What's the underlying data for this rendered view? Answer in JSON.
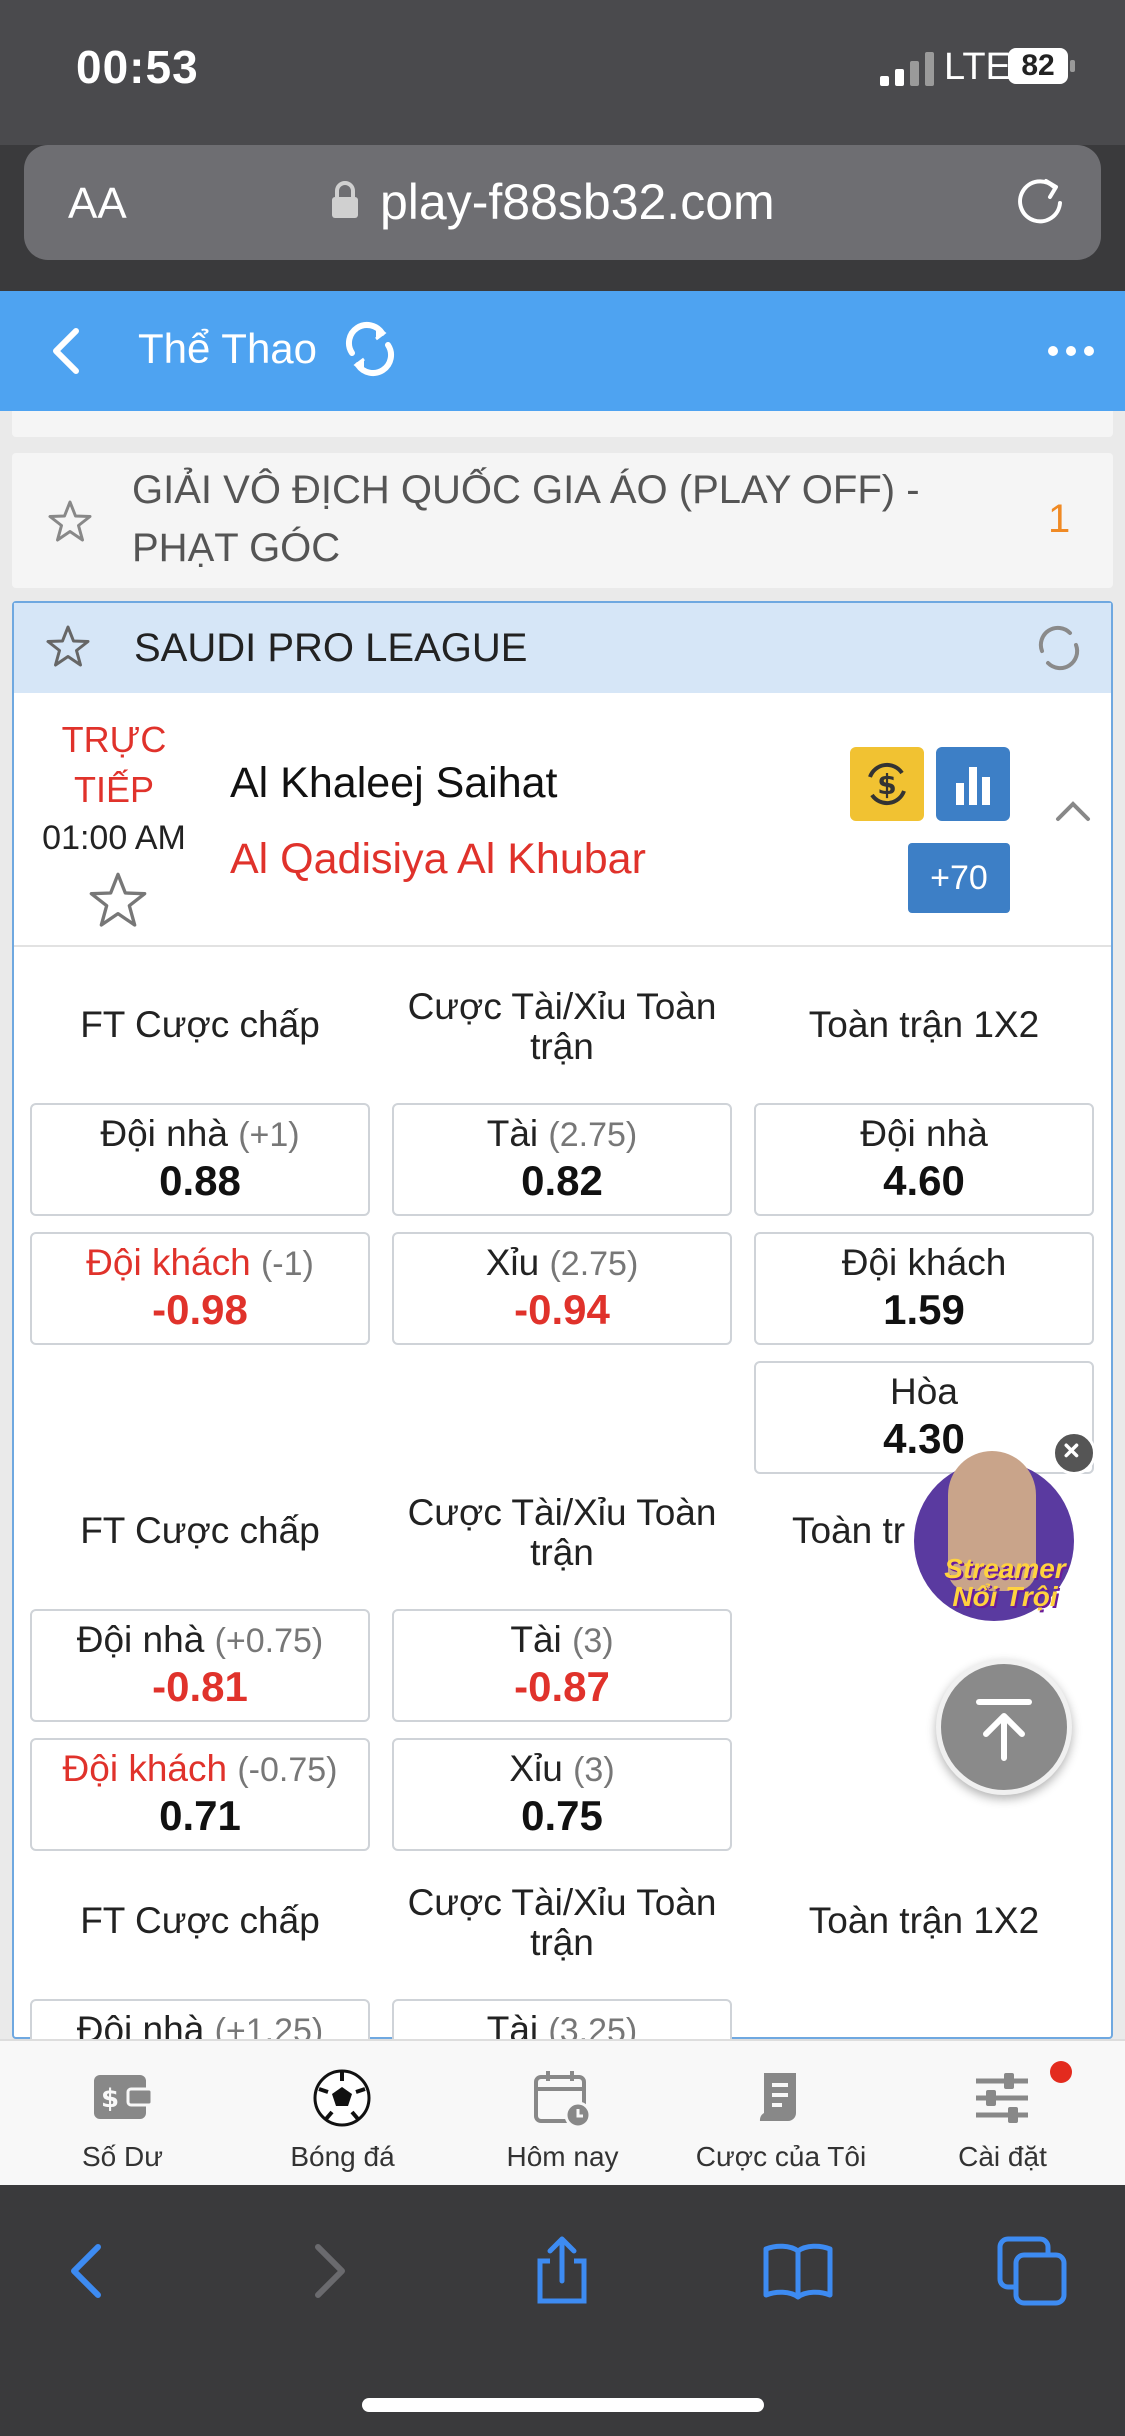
{
  "status": {
    "time": "00:53",
    "network": "LTE",
    "battery": "82"
  },
  "browser": {
    "text_size": "AA",
    "url": "play-f88sb32.com"
  },
  "header": {
    "title": "Thể Thao"
  },
  "leagues": [
    {
      "name": "GIẢI VÔ ĐỊCH QUỐC GIA ÁO (PLAY OFF) - PHẠT GÓC",
      "count": "1"
    },
    {
      "name": "SAUDI PRO LEAGUE"
    }
  ],
  "match": {
    "status_line1": "TRỰC",
    "status_line2": "TIẾP",
    "time": "01:00 AM",
    "home_team": "Al Khaleej Saihat",
    "away_team": "Al Qadisiya Al Khubar",
    "more_markets": "+70"
  },
  "markets": [
    {
      "headers": [
        "FT Cược chấp",
        "Cược Tài/Xỉu Toàn trận",
        "Toàn trận 1X2"
      ],
      "handicap": [
        {
          "label": "Đội nhà",
          "line": "(+1)",
          "odds": "0.88"
        },
        {
          "label": "Đội khách",
          "line": "(-1)",
          "odds": "-0.98"
        }
      ],
      "overunder": [
        {
          "label": "Tài",
          "line": "(2.75)",
          "odds": "0.82"
        },
        {
          "label": "Xỉu",
          "line": "(2.75)",
          "odds": "-0.94"
        }
      ],
      "x12": [
        {
          "label": "Đội nhà",
          "odds": "4.60"
        },
        {
          "label": "Đội khách",
          "odds": "1.59"
        },
        {
          "label": "Hòa",
          "odds": "4.30"
        }
      ]
    },
    {
      "headers": [
        "FT Cược chấp",
        "Cược Tài/Xỉu Toàn trận",
        "Toàn tr"
      ],
      "handicap": [
        {
          "label": "Đội nhà",
          "line": "(+0.75)",
          "odds": "-0.81"
        },
        {
          "label": "Đội khách",
          "line": "(-0.75)",
          "odds": "0.71"
        }
      ],
      "overunder": [
        {
          "label": "Tài",
          "line": "(3)",
          "odds": "-0.87"
        },
        {
          "label": "Xỉu",
          "line": "(3)",
          "odds": "0.75"
        }
      ]
    },
    {
      "headers": [
        "FT Cược chấp",
        "Cược Tài/Xỉu Toàn trận",
        "Toàn trận 1X2"
      ],
      "handicap": [
        {
          "label": "Đội nhà",
          "line": "(+1.25)"
        }
      ],
      "overunder": [
        {
          "label": "Tài",
          "line": "(3.25)"
        }
      ]
    }
  ],
  "promo": {
    "line1": "Streamer",
    "line2": "Nổi Trội"
  },
  "bottom_nav": [
    {
      "label": "Số Dư",
      "icon": "wallet-icon"
    },
    {
      "label": "Bóng đá",
      "icon": "soccer-ball-icon"
    },
    {
      "label": "Hôm nay",
      "icon": "calendar-icon"
    },
    {
      "label": "Cược của Tôi",
      "icon": "bet-slip-icon"
    },
    {
      "label": "Cài đặt",
      "icon": "settings-sliders-icon"
    }
  ],
  "colors": {
    "header_blue": "#4ea3f1",
    "odds_red": "#e0322b",
    "live_red": "#e0322b",
    "league_header_bg": "#d6e6f7"
  }
}
